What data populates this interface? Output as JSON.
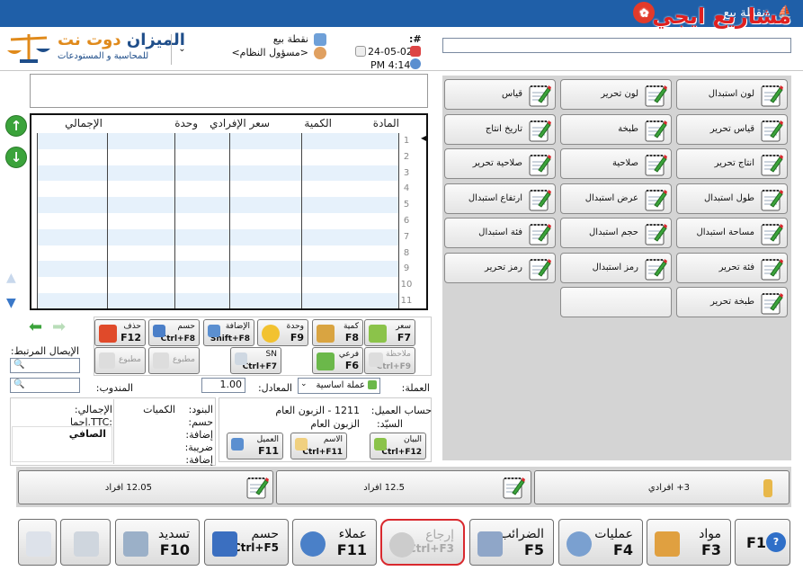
{
  "window": {
    "title": "نقطة بيع"
  },
  "watermark": "مشاريع ايجي",
  "logo": {
    "name_main": "الميزان",
    "name_suffix": "دوت نت",
    "subtitle": "للمحاسبة و المستودعات"
  },
  "header": {
    "hash_label": "#:",
    "date": "24-05-02",
    "time": "PM 4:14",
    "station": "نقطة بيع",
    "user": "<مسؤول النظام>",
    "barcode_value": ""
  },
  "grid": {
    "columns": [
      "المادة",
      "الكمية",
      "سعر الإفرادي",
      "وحدة",
      "الإجمالي"
    ],
    "row_numbers": [
      "1",
      "2",
      "3",
      "4",
      "5",
      "6",
      "7",
      "8",
      "9",
      "10",
      "11"
    ]
  },
  "quick_items": [
    "لون استبدال",
    "لون تحرير",
    "قياس",
    "قياس تحرير",
    "طبخة",
    "تاريخ انتاج",
    "انتاج تحرير",
    "صلاحية",
    "صلاحية تحرير",
    "طول استبدال",
    "عرض استبدال",
    "ارتفاع استبدال",
    "مساحة استبدال",
    "حجم استبدال",
    "فئة استبدال",
    "فئة تحرير",
    "رمز استبدال",
    "رمز تحرير",
    "طبخة تحرير",
    ""
  ],
  "function_keys": {
    "price": {
      "name": "سعر",
      "key": "F7"
    },
    "qty": {
      "name": "كمية",
      "key": "F8"
    },
    "unit": {
      "name": "وحدة",
      "key": "F9"
    },
    "add": {
      "name": "الإضافة",
      "key": "Shift+F8"
    },
    "discount": {
      "name": "حسم",
      "key": "Ctrl+F8"
    },
    "delete": {
      "name": "حذف",
      "key": "F12"
    },
    "note": {
      "name": "ملاحظة",
      "key": "Ctrl+F9"
    },
    "sub": {
      "name": "فرعي",
      "key": "F6"
    },
    "sn": {
      "name": "SN",
      "key": "Ctrl+F7"
    },
    "printed1": "مطبوع",
    "printed2": "مطبوع"
  },
  "left_panel": {
    "receipt_label": "الإيصال المرتبط:",
    "rep_label": "المندوب:"
  },
  "currency": {
    "label": "العملة:",
    "value": "عملة اساسية",
    "rate_label": "المعادل:",
    "rate": "1.00"
  },
  "customer": {
    "account_label": "حساب العميل:",
    "account_value": "1211 - الزبون العام",
    "mr_label": "السيّد:",
    "mr_value": "الزبون العام",
    "statement": {
      "name": "البيان",
      "key": "Ctrl+F12"
    },
    "name_btn": {
      "name": "الاسم",
      "key": "Ctrl+F11"
    },
    "client_btn": {
      "name": "العميل",
      "key": "F11"
    }
  },
  "summary": {
    "items_label": "البنود:",
    "qty_label": "الكميات",
    "discount_label": "حسم:",
    "addition_label": "إضافة:",
    "tax_label": "ضريبة:",
    "addition2_label": "إضافة:",
    "total_label": "الإجمالي:",
    "ttc_label": "إجما.TTC:",
    "net_label": "الصافي"
  },
  "quantity_buttons": [
    "3+ افرادي",
    "12.5 افراد",
    "12.05 افراد"
  ],
  "bottom_buttons": {
    "help": {
      "key": "F1"
    },
    "materials": {
      "name": "مواد",
      "key": "F3"
    },
    "operations": {
      "name": "عمليات",
      "key": "F4"
    },
    "taxes": {
      "name": "الضرائب",
      "key": "F5"
    },
    "return": {
      "name": "إرجاع",
      "key": "Ctrl+F3"
    },
    "clients": {
      "name": "عملاء",
      "key": "F11"
    },
    "discount": {
      "name": "حسم",
      "key": "Ctrl+F5"
    },
    "settle": {
      "name": "تسديد",
      "key": "F10"
    }
  },
  "colors": {
    "titlebar": "#1f5fa8",
    "accent_green": "#3ba33b",
    "highlight": "#d9292e"
  }
}
